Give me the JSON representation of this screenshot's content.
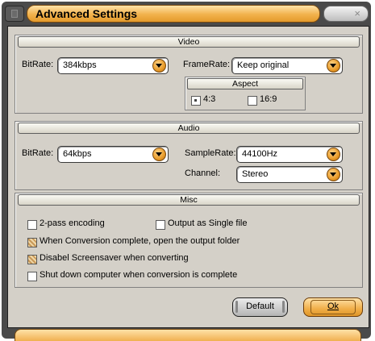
{
  "window": {
    "title": "Advanced Settings",
    "close_label": "×"
  },
  "video": {
    "header": "Video",
    "bitrate_label": "BitRate:",
    "bitrate_value": "384kbps",
    "framerate_label": "FrameRate:",
    "framerate_value": "Keep original",
    "aspect": {
      "header": "Aspect",
      "option1": "4:3",
      "option2": "16:9"
    }
  },
  "audio": {
    "header": "Audio",
    "bitrate_label": "BitRate:",
    "bitrate_value": "64kbps",
    "samplerate_label": "SampleRate:",
    "samplerate_value": "44100Hz",
    "channel_label": "Channel:",
    "channel_value": "Stereo"
  },
  "misc": {
    "header": "Misc",
    "two_pass": "2-pass encoding",
    "single_file": "Output as Single file",
    "open_folder": "When Conversion complete, open the output folder",
    "disable_screensaver": "Disabel Screensaver when converting",
    "shutdown": "Shut down computer when conversion is complete"
  },
  "buttons": {
    "default": "Default",
    "ok": "Ok"
  },
  "colors": {
    "accent": "#f2b24c",
    "dialog_bg": "#d4d0c8",
    "frame": "#4a4a4a"
  }
}
